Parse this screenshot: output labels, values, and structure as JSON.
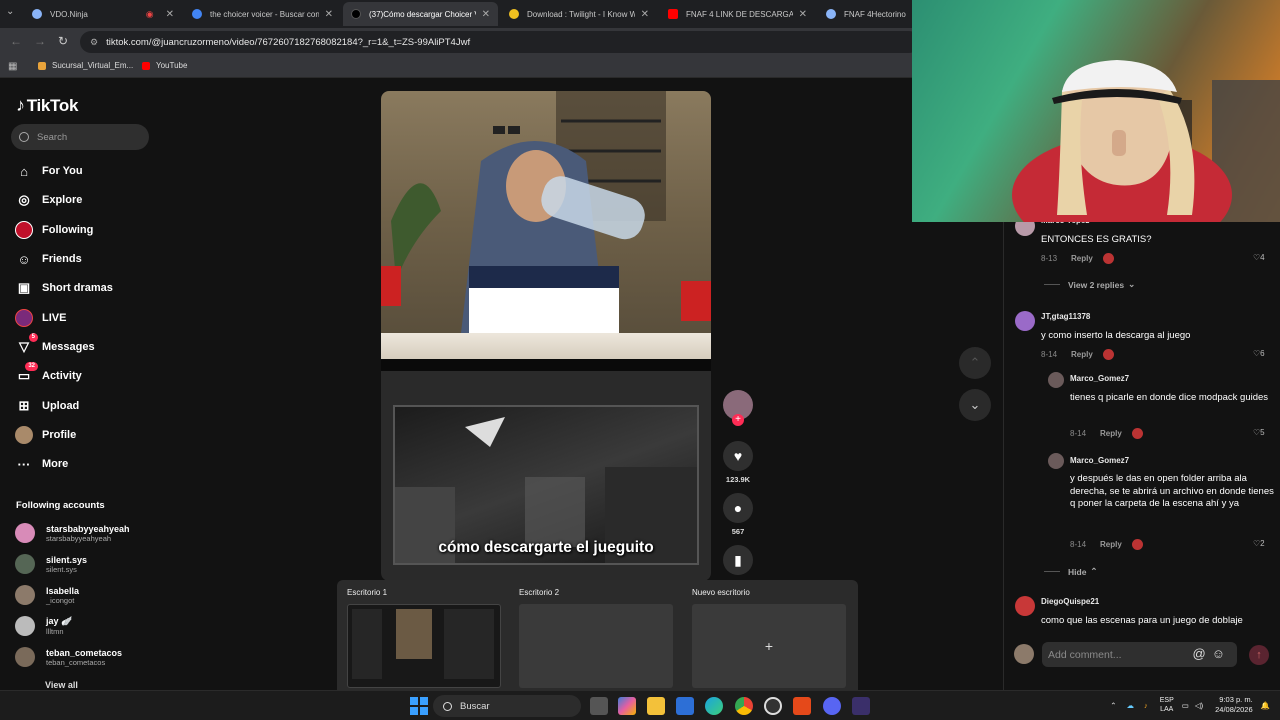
{
  "browser": {
    "tabs": [
      {
        "title": "VDO.Ninja",
        "icon": "globe-icon",
        "color": "#8ab4f8"
      },
      {
        "title": "the choicer voicer - Buscar con",
        "icon": "google-icon",
        "color": "#4285f4"
      },
      {
        "title": "(37)Cómo descargar Choicer V",
        "icon": "tiktok-icon",
        "color": "#000000"
      },
      {
        "title": "Download : Twilight - I Know W",
        "icon": "moon-icon",
        "color": "#f0c020"
      },
      {
        "title": "FNAF 4 LINK DE DESCARGA - Y",
        "icon": "youtube-icon",
        "color": "#ff0000"
      },
      {
        "title": "FNAF 4Hectorinozz",
        "icon": "globe-icon",
        "color": "#8ab4f8"
      }
    ],
    "url": "tiktok.com/@juancruzormeno/video/7672607182768082184?_r=1&_t=ZS-99AliPT4Jwf",
    "bookmarks": [
      {
        "label": "Sucursal_Virtual_Em...",
        "icon": "bookmark-icon",
        "color": "#e8a33b"
      },
      {
        "label": "YouTube",
        "icon": "youtube-icon",
        "color": "#ff0000"
      }
    ]
  },
  "tiktok": {
    "logo": "TikTok",
    "search_placeholder": "Search",
    "nav": [
      {
        "label": "For You",
        "icon": "home-icon",
        "glyph": "⌂"
      },
      {
        "label": "Explore",
        "icon": "compass-icon",
        "glyph": "◎"
      },
      {
        "label": "Following",
        "icon": "following-icon",
        "glyph": "●"
      },
      {
        "label": "Friends",
        "icon": "friends-icon",
        "glyph": "☺"
      },
      {
        "label": "Short dramas",
        "icon": "film-icon",
        "glyph": "▣"
      },
      {
        "label": "LIVE",
        "icon": "live-icon",
        "glyph": "◉"
      },
      {
        "label": "Messages",
        "icon": "messages-icon",
        "glyph": "▽",
        "badge": "5"
      },
      {
        "label": "Activity",
        "icon": "activity-icon",
        "glyph": "▭",
        "badge": "32"
      },
      {
        "label": "Upload",
        "icon": "upload-icon",
        "glyph": "⊞"
      },
      {
        "label": "Profile",
        "icon": "profile-icon",
        "glyph": "●"
      },
      {
        "label": "More",
        "icon": "more-icon",
        "glyph": "···"
      }
    ],
    "following_header": "Following accounts",
    "following": [
      {
        "name": "starsbabyyeahyeah",
        "handle": "starsbabyyeahyeah",
        "color": "#d88bb8"
      },
      {
        "name": "silent.sys",
        "handle": "silent.sys",
        "color": "#556655"
      },
      {
        "name": "Isabella",
        "handle": "_icongot",
        "color": "#8c7a6a"
      },
      {
        "name": "jay 🪽",
        "handle": "llltmn",
        "color": "#bbbbbb"
      },
      {
        "name": "teban_cometacos",
        "handle": "teban_cometacos",
        "color": "#7a6a5a"
      }
    ],
    "view_all": "View all"
  },
  "video": {
    "caption": "cómo descargarte el jueguito",
    "likes": "123.9K",
    "comments_count": "567"
  },
  "comments": [
    {
      "user": "Marco Yepez",
      "text": "ENTONCES ES GRATIS?",
      "date": "8-13",
      "reply": "Reply",
      "likes": "4",
      "view_replies": "View 2 replies"
    },
    {
      "user": "JT,gtag11378",
      "text": "y como inserto la descarga al juego",
      "date": "8-14",
      "reply": "Reply",
      "likes": "6"
    },
    {
      "user": "Marco_Gomez7",
      "text": "tienes q picarle en donde dice modpack guides",
      "date": "8-14",
      "reply": "Reply",
      "likes": "5"
    },
    {
      "user": "Marco_Gomez7",
      "text": "y después le das en open folder arriba ala derecha, se te abrirá un archivo en donde tienes q poner la carpeta de la escena ahí y ya",
      "date": "8-14",
      "reply": "Reply",
      "likes": "2"
    },
    {
      "hide": "Hide"
    },
    {
      "user": "DiegoQuispe21",
      "text": "como que las escenas para un juego de doblaje"
    }
  ],
  "comment_input_placeholder": "Add comment...",
  "taskview": {
    "desktops": [
      "Escritorio 1",
      "Escritorio 2",
      "Nuevo escritorio"
    ],
    "add": "+"
  },
  "taskbar": {
    "search": "Buscar",
    "lang_top": "ESP",
    "lang_bottom": "LAA",
    "time": "9:03 p. m.",
    "date": "24/08/2026"
  }
}
